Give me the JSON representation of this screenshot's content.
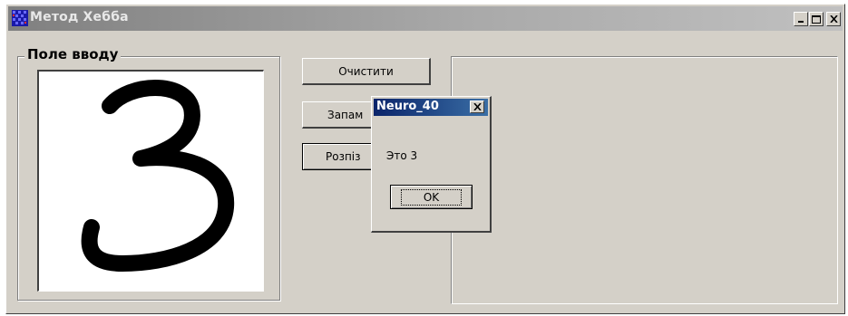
{
  "window": {
    "title": "Метод Хебба",
    "buttons": [
      "minimize",
      "maximize",
      "close"
    ]
  },
  "input_group": {
    "label": "Поле вводу",
    "drawn_glyph": "3"
  },
  "buttons": {
    "clear": "Очистити",
    "remember": "Запам",
    "recognize": "Розпіз"
  },
  "dialog": {
    "title": "Neuro_40",
    "message": "Это 3",
    "ok_label": "OK"
  },
  "colors": {
    "face": "#d4d0c8",
    "dialog_title": "#0a246a",
    "inactive_title": "#808080"
  }
}
